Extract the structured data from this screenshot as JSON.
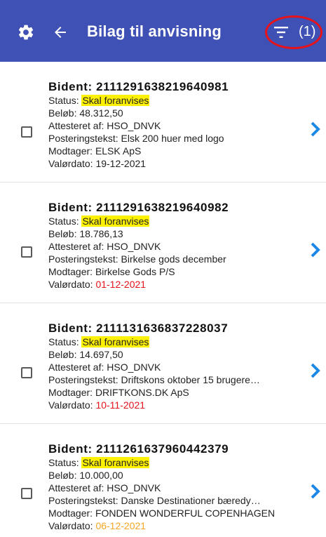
{
  "appbar": {
    "title": "Bilag til anvisning",
    "filter_count": "(1)",
    "accent": "#3f51b5",
    "icons": [
      "gear-icon",
      "back-arrow-icon",
      "filter-icon"
    ]
  },
  "labels": {
    "status": "Status: ",
    "amount": "Beløb: ",
    "attested": "Attesteret af: ",
    "text": "Posteringstekst: ",
    "receiver": "Modtager: ",
    "date": "Valørdato: "
  },
  "items": [
    {
      "bident": "Bident: 2111291638219640981",
      "status": "Skal foranvises",
      "amount": "48.312,50",
      "attested": "HSO_DNVK",
      "text": "Elsk 200 huer med logo",
      "receiver": "ELSK ApS",
      "date": "19-12-2021",
      "date_color": "#222222"
    },
    {
      "bident": "Bident: 2111291638219640982",
      "status": "Skal foranvises",
      "amount": "18.786,13",
      "attested": "HSO_DNVK",
      "text": "Birkelse gods december",
      "receiver": "Birkelse Gods P/S",
      "date": "01-12-2021",
      "date_color": "#e8121a"
    },
    {
      "bident": "Bident: 2111131636837228037",
      "status": "Skal foranvises",
      "amount": "14.697,50",
      "attested": "HSO_DNVK",
      "text": "Driftskons oktober 15 brugere…",
      "receiver": "DRIFTKONS.DK ApS",
      "date": "10-11-2021",
      "date_color": "#e8121a"
    },
    {
      "bident": "Bident: 2111261637960442379",
      "status": "Skal foranvises",
      "amount": "10.000,00",
      "attested": "HSO_DNVK",
      "text": "Danske Destinationer bæredy…",
      "receiver": "FONDEN WONDERFUL COPENHAGEN",
      "date": "06-12-2021",
      "date_color": "#f5a623"
    }
  ]
}
